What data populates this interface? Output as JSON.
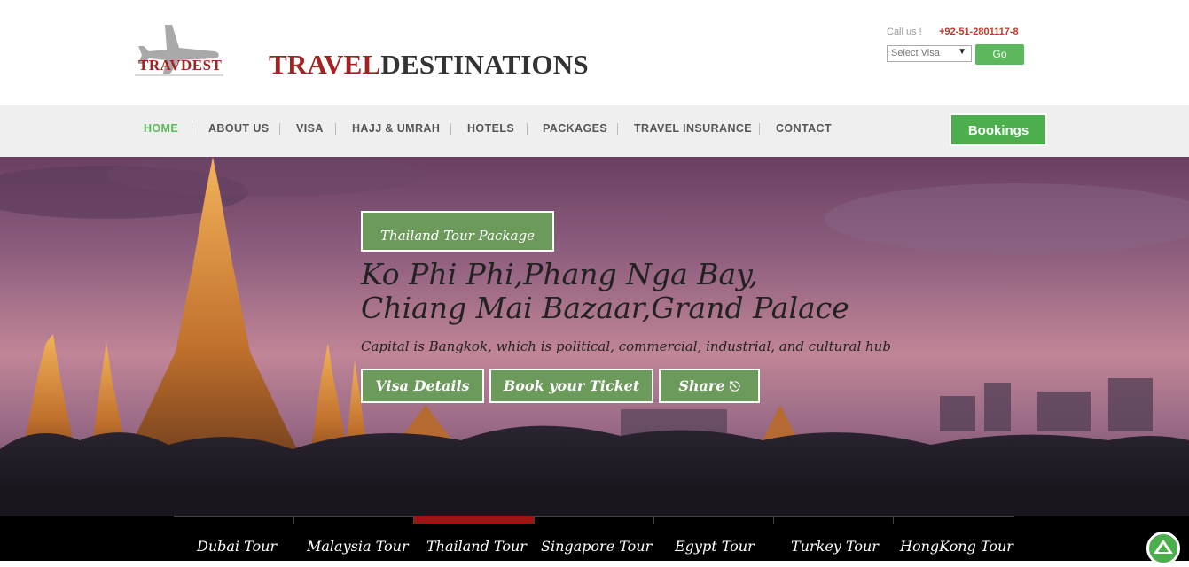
{
  "header": {
    "logo_text": "TRAVDEST",
    "title_part1": "TRAVEL",
    "title_part2": "DESTINATIONS",
    "call_label": "Call us !",
    "phone": "+92-51-2801117-8",
    "visa_select": "Select Visa",
    "go_label": "Go"
  },
  "nav": {
    "items": [
      "HOME",
      "ABOUT US",
      "VISA",
      "HAJJ & UMRAH",
      "HOTELS",
      "PACKAGES",
      "TRAVEL INSURANCE",
      "CONTACT"
    ],
    "active": "HOME",
    "bookings_label": "Bookings"
  },
  "hero": {
    "tag": "Thailand Tour Package",
    "title_line1": "Ko Phi Phi,Phang Nga Bay,",
    "title_line2": "Chiang Mai Bazaar,Grand Palace",
    "subtitle": "Capital is Bangkok, which is political, commercial, industrial, and cultural hub",
    "buttons": [
      "Visa Details",
      "Book your Ticket",
      "Share"
    ]
  },
  "tours": {
    "items": [
      "Dubai Tour",
      "Malaysia Tour",
      "Thailand Tour",
      "Singapore Tour",
      "Egypt Tour",
      "Turkey Tour",
      "HongKong Tour"
    ],
    "active": "Thailand Tour"
  },
  "colors": {
    "accent_green": "#5cb85c",
    "brand_red": "#a32222"
  }
}
